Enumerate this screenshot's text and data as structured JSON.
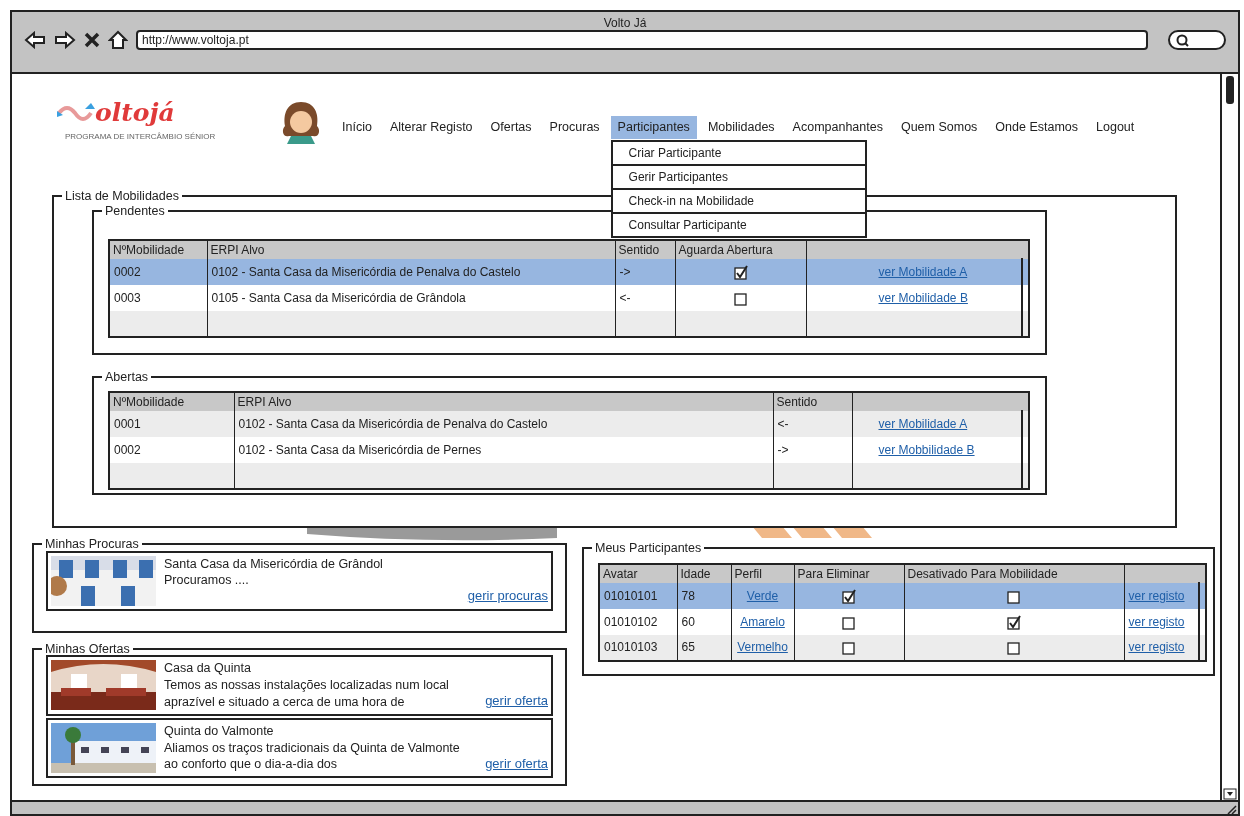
{
  "window": {
    "title": "Volto Já",
    "url": "http://www.voltoja.pt"
  },
  "logo": {
    "text": "oltojá",
    "tagline": "PROGRAMA DE INTERCÂMBIO SÉNIOR"
  },
  "nav": {
    "items": [
      {
        "label": "Início",
        "selected": false
      },
      {
        "label": "Alterar Registo",
        "selected": false
      },
      {
        "label": "Ofertas",
        "selected": false
      },
      {
        "label": "Procuras",
        "selected": false
      },
      {
        "label": "Participantes",
        "selected": true
      },
      {
        "label": "Mobilidades",
        "selected": false
      },
      {
        "label": "Acompanhantes",
        "selected": false
      },
      {
        "label": "Quem Somos",
        "selected": false
      },
      {
        "label": "Onde Estamos",
        "selected": false
      },
      {
        "label": "Logout",
        "selected": false
      }
    ],
    "dropdown": [
      "Criar Participante",
      "Gerir Participantes",
      "Check-in na Mobilidade",
      "Consultar Participante"
    ]
  },
  "lista_de_mobilidades": {
    "title": "Lista de Mobilidades",
    "pendentes": {
      "title": "Pendentes",
      "columns": [
        "NºMobilidade",
        "ERPI Alvo",
        "Sentido",
        "Aguarda Abertura"
      ],
      "rows": [
        {
          "numero": "0002",
          "erpi": "0102 - Santa Casa da Misericórdia de Penalva do Castelo",
          "sentido": "->",
          "aguarda_abertura": true,
          "link": "ver Mobilidade A",
          "selected": true
        },
        {
          "numero": "0003",
          "erpi": "0105 - Santa Casa da Misericórdia de Grândola",
          "sentido": "<-",
          "aguarda_abertura": false,
          "link": "ver Mobilidade B",
          "selected": false
        }
      ]
    },
    "abertas": {
      "title": "Abertas",
      "columns": [
        "NºMobilidade",
        "ERPI Alvo",
        "Sentido"
      ],
      "rows": [
        {
          "numero": "0001",
          "erpi": "0102 - Santa Casa da Misericórdia de Penalva do Castelo",
          "sentido": "<-",
          "link": "ver Mobilidade A",
          "selected": false
        },
        {
          "numero": "0002",
          "erpi": "0102 - Santa Casa da Misericórdia de Pernes",
          "sentido": "->",
          "link": "ver Mobbilidade B",
          "selected": false
        }
      ]
    }
  },
  "minhas_procuras": {
    "title": "Minhas Procuras",
    "items": [
      {
        "title": "Santa Casa da Misericórdia de Grândol",
        "text": "Procuramos ....",
        "link": "gerir procuras"
      }
    ]
  },
  "minhas_ofertas": {
    "title": "Minhas Ofertas",
    "items": [
      {
        "title": "Casa da Quinta",
        "text": "Temos as nossas instalações localizadas num local aprazível e situado a cerca de uma hora de",
        "link": "gerir oferta"
      },
      {
        "title": "Quinta do Valmonte",
        "text": "Aliamos os traços tradicionais da Quinta de Valmonte ao conforto que o dia-a-dia dos",
        "link": "gerir oferta"
      }
    ]
  },
  "meus_participantes": {
    "title": "Meus Participantes",
    "columns": [
      "Avatar",
      "Idade",
      "Perfil",
      "Para Eliminar",
      "Desativado Para Mobilidade"
    ],
    "rows": [
      {
        "avatar": "01010101",
        "idade": "78",
        "perfil": "Verde",
        "para_eliminar": true,
        "desativado": false,
        "link": "ver registo",
        "selected": true
      },
      {
        "avatar": "01010102",
        "idade": "60",
        "perfil": "Amarelo",
        "para_eliminar": false,
        "desativado": true,
        "link": "ver registo",
        "selected": false
      },
      {
        "avatar": "01010103",
        "idade": "65",
        "perfil": "Vermelho",
        "para_eliminar": false,
        "desativado": false,
        "link": "ver registo",
        "selected": false
      }
    ]
  }
}
